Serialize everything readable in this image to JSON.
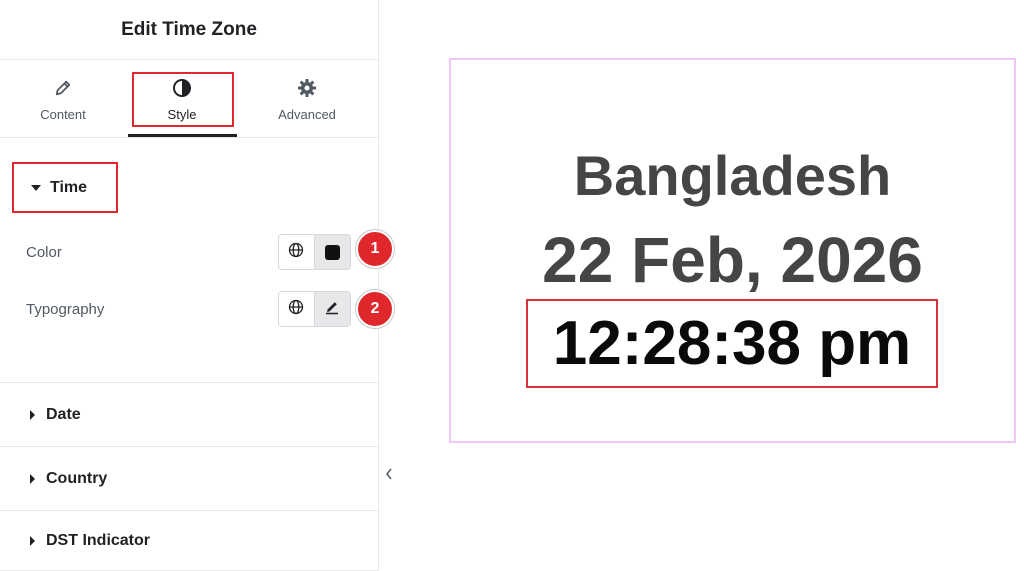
{
  "panel": {
    "title": "Edit Time Zone",
    "tabs": [
      {
        "label": "Content",
        "icon": "pencil-icon"
      },
      {
        "label": "Style",
        "icon": "contrast-icon"
      },
      {
        "label": "Advanced",
        "icon": "gear-icon"
      }
    ],
    "active_tab": "Style",
    "time_section": {
      "title": "Time",
      "controls": [
        {
          "label": "Color",
          "value_color": "#111111"
        },
        {
          "label": "Typography"
        }
      ]
    },
    "sections": [
      {
        "label": "Date"
      },
      {
        "label": "Country"
      },
      {
        "label": "DST Indicator"
      }
    ]
  },
  "annotations": [
    "1",
    "2"
  ],
  "preview": {
    "country": "Bangladesh",
    "date": "22 Feb, 2026",
    "time": "12:28:38 pm"
  },
  "colors": {
    "highlight": "#e0282c",
    "preview_border": "#f1c6f5",
    "text_dark": "#454545"
  }
}
